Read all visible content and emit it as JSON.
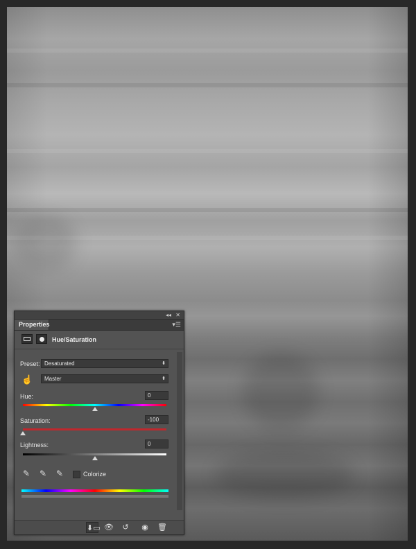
{
  "panel": {
    "collapse_glyph": "◂◂",
    "close_glyph": "✕",
    "tab_label": "Properties",
    "tab_menu_glyph": "▾☰",
    "title": "Hue/Saturation",
    "preset_label": "Preset:",
    "preset_value": "Desaturated",
    "channel_value": "Master",
    "hue_label": "Hue:",
    "hue_value": "0",
    "saturation_label": "Saturation:",
    "saturation_value": "-100",
    "lightness_label": "Lightness:",
    "lightness_value": "0",
    "colorize_label": "Colorize",
    "colorize_checked": false,
    "icons": {
      "adjustment": "adjustment-layer-icon",
      "mask": "mask-icon",
      "targeted_adjust": "hand-targeted-adjust-icon",
      "eyedropper": "eyedropper-icon",
      "eyedropper_add": "eyedropper-plus-icon",
      "eyedropper_subtract": "eyedropper-minus-icon",
      "clip": "clip-to-layer-icon",
      "view_previous": "view-previous-state-icon",
      "reset": "reset-icon",
      "visibility": "eye-icon",
      "delete": "trash-icon"
    },
    "glyphs": {
      "arrow": "⬍",
      "dropper": "✎",
      "clip": "⬇▭",
      "view_previous": "👁",
      "reset": "↺",
      "visibility": "◉",
      "delete": "🗑"
    },
    "slider_fractions": {
      "hue": 0.5,
      "saturation": 0.0,
      "lightness": 0.5
    }
  },
  "colors": {
    "workspace_bg": "#282828",
    "panel_bg": "#535353",
    "saturation_track": "#c0282d"
  }
}
